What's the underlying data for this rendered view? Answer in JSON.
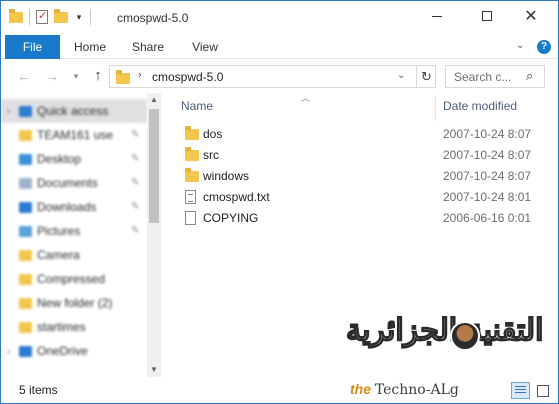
{
  "window": {
    "title": "cmospwd-5.0",
    "controls": {
      "minimize": "minimize",
      "maximize": "maximize",
      "close": "✕"
    }
  },
  "ribbon": {
    "tabs": [
      {
        "label": "File",
        "active": true
      },
      {
        "label": "Home"
      },
      {
        "label": "Share"
      },
      {
        "label": "View"
      }
    ],
    "help": "?"
  },
  "address_bar": {
    "path": "cmospwd-5.0",
    "separator": "›",
    "search_placeholder": "Search c..."
  },
  "nav_pane": {
    "items": [
      {
        "label": "Quick access",
        "icon": "star-icon",
        "active": true
      },
      {
        "label": "TEAM161 use",
        "icon": "folder-icon",
        "pinned": true
      },
      {
        "label": "Desktop",
        "icon": "desktop-icon",
        "pinned": true
      },
      {
        "label": "Documents",
        "icon": "documents-icon",
        "pinned": true
      },
      {
        "label": "Downloads",
        "icon": "downloads-icon",
        "pinned": true
      },
      {
        "label": "Pictures",
        "icon": "pictures-icon",
        "pinned": true
      },
      {
        "label": "Camera",
        "icon": "folder-icon"
      },
      {
        "label": "Compressed",
        "icon": "folder-icon"
      },
      {
        "label": "New folder (2)",
        "icon": "folder-icon"
      },
      {
        "label": "startimes",
        "icon": "folder-icon"
      },
      {
        "label": "OneDrive",
        "icon": "onedrive-icon"
      }
    ]
  },
  "file_list": {
    "columns": {
      "name": "Name",
      "date": "Date modified"
    },
    "rows": [
      {
        "name": "dos",
        "date": "2007-10-24 8:07",
        "type": "folder"
      },
      {
        "name": "src",
        "date": "2007-10-24 8:07",
        "type": "folder"
      },
      {
        "name": "windows",
        "date": "2007-10-24 8:07",
        "type": "folder"
      },
      {
        "name": "cmospwd.txt",
        "date": "2007-10-24 8:01",
        "type": "text"
      },
      {
        "name": "COPYING",
        "date": "2006-06-16 0:01",
        "type": "file"
      }
    ]
  },
  "status_bar": {
    "item_count": "5 items"
  },
  "watermark": {
    "arabic": "التقنية الجزائرية",
    "the": "the",
    "brand": "Techno-ALg"
  },
  "colors": {
    "accent": "#1979ca",
    "folder": "#f3c64c",
    "header_text": "#4c607a"
  }
}
